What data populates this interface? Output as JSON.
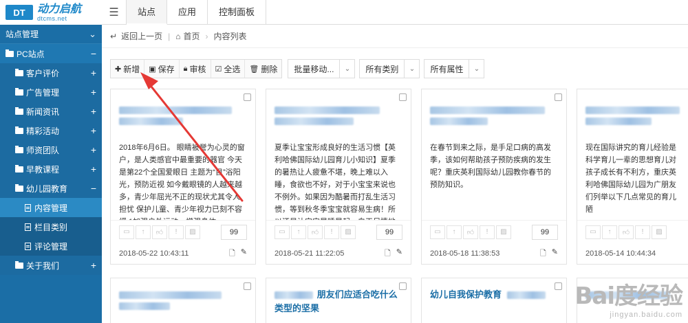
{
  "logo": {
    "badge": "DT",
    "name": "动力启航",
    "url": "dtcms.net"
  },
  "topnav": [
    {
      "label": "站点"
    },
    {
      "label": "应用"
    },
    {
      "label": "控制面板"
    }
  ],
  "sidebar": {
    "section": "站点管理",
    "group": "PC站点",
    "items": [
      {
        "label": "客户评价"
      },
      {
        "label": "广告管理"
      },
      {
        "label": "新闻资讯"
      },
      {
        "label": "精彩活动"
      },
      {
        "label": "师资团队"
      },
      {
        "label": "早教课程"
      },
      {
        "label": "幼儿园教育"
      },
      {
        "label": "关于我们"
      }
    ],
    "subitems": [
      {
        "label": "内容管理"
      },
      {
        "label": "栏目类别"
      },
      {
        "label": "评论管理"
      }
    ]
  },
  "breadcrumb": {
    "back": "返回上一页",
    "home": "首页",
    "current": "内容列表"
  },
  "toolbar": {
    "add": "新增",
    "save": "保存",
    "audit": "审核",
    "select_all": "全选",
    "delete": "删除",
    "batch_move": "批量移动...",
    "all_categories": "所有类别",
    "all_attrs": "所有属性"
  },
  "cards": [
    {
      "title_visible": "",
      "body": "2018年6月6日。 眼睛被誉为心灵的窗户，是人类感官中最重要的器官 今天是第22个全国爱眼日 主题为“目”浴阳光，预防近视 如今戴眼镜的人越来越多，青少年屈光不正的现状尤其令人担忧 保护儿童、青少年视力已刻不容缓 1加强户外运动，增强身体...",
      "sort": "99",
      "date": "2018-05-22 10:43:11"
    },
    {
      "title_visible": "",
      "body": "夏季让宝宝形成良好的生活习惯【英利哈佛国际幼儿园育儿小知识】夏季的暑热让人疲惫不堪，晚上难以入睡，食欲也不好，对于小宝宝来说也不例外。如果因为酷暑而打乱生活习惯，等到秋冬季宝宝就容易生病！所以还是让宝宝早睡早起，白天尽情地玩耍，消耗体力，晚上美美地睡",
      "sort": "99",
      "date": "2018-05-21 11:22:05"
    },
    {
      "title_visible": "",
      "body": "在春节到来之际，是手足口病的高发季，该如何帮助孩子预防疾病的发生呢？重庆英利国际幼儿园教你春节的预防知识。",
      "sort": "99",
      "date": "2018-05-18 11:38:53"
    },
    {
      "title_visible": "",
      "body": "现在国际讲究的育儿经验是科学育儿一辈的思想育儿对孩子成长有不利方，重庆英利哈佛国际幼儿园为广朋友们列举以下几点常见的育儿陋",
      "sort": "99",
      "date": "2018-05-14 10:44:34"
    }
  ],
  "row2_cards": [
    {
      "title": ""
    },
    {
      "title": "朋友们应适合吃什么类型的坚果"
    },
    {
      "title": "幼儿自我保护教育"
    },
    {
      "title": ""
    }
  ],
  "watermark": {
    "main": "Bai度经验",
    "sub": "jingyan.baidu.com"
  },
  "colors": {
    "sidebar": "#1b6ea6",
    "accent": "#1e88c9",
    "arrow": "#e53935"
  }
}
